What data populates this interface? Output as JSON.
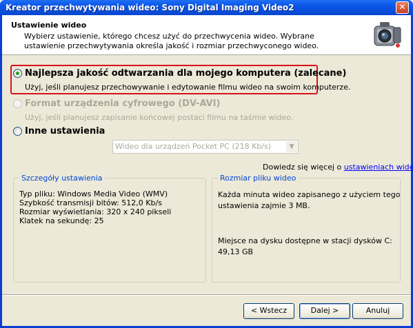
{
  "window": {
    "title": "Kreator przechwytywania wideo: Sony Digital Imaging Video2",
    "close": "✕"
  },
  "header": {
    "title": "Ustawienie wideo",
    "description": "Wybierz ustawienie, którego chcesz użyć do przechwycenia wideo. Wybrane ustawienie przechwytywania określa jakość i rozmiar przechwyconego wideo.",
    "icon": "camcorder-icon"
  },
  "options": [
    {
      "label": "Najlepsza jakość odtwarzania dla mojego komputera (zalecane)",
      "description": "Użyj, jeśli planujesz przechowywanie i edytowanie filmu wideo na swoim komputerze.",
      "selected": true,
      "enabled": true
    },
    {
      "label": "Format urządzenia cyfrowego (DV-AVI)",
      "description": "Użyj, jeśli planujesz zapisanie końcowej postaci filmu na taśmie wideo.",
      "selected": false,
      "enabled": false
    },
    {
      "label": "Inne ustawienia",
      "selected": false,
      "enabled": true
    }
  ],
  "other_settings_select": {
    "value": "Wideo dla urządzeń Pocket PC (218 Kb/s)"
  },
  "more_info": {
    "text": "Dowiedz się więcej o",
    "link": "ustawieniach wideo."
  },
  "details": {
    "title": "Szczegóły ustawienia",
    "lines": [
      "Typ pliku: Windows Media Video (WMV)",
      "Szybkość transmisji bitów: 512,0 Kb/s",
      "Rozmiar wyświetlania: 320 x 240 pikseli",
      "Klatek na sekundę: 25"
    ]
  },
  "file_size": {
    "title": "Rozmiar pliku wideo",
    "line1": "Każda minuta wideo zapisanego z użyciem tego",
    "line2": "ustawienia zajmie 3 MB.",
    "disk1": "Miejsce na dysku dostępne w stacji dysków C:",
    "disk2": "49,13 GB"
  },
  "buttons": {
    "back": "< Wstecz",
    "next": "Dalej >",
    "cancel": "Anuluj"
  },
  "colors": {
    "highlight": "#d8111b",
    "link": "#0000ff",
    "group_title": "#0046d5"
  }
}
